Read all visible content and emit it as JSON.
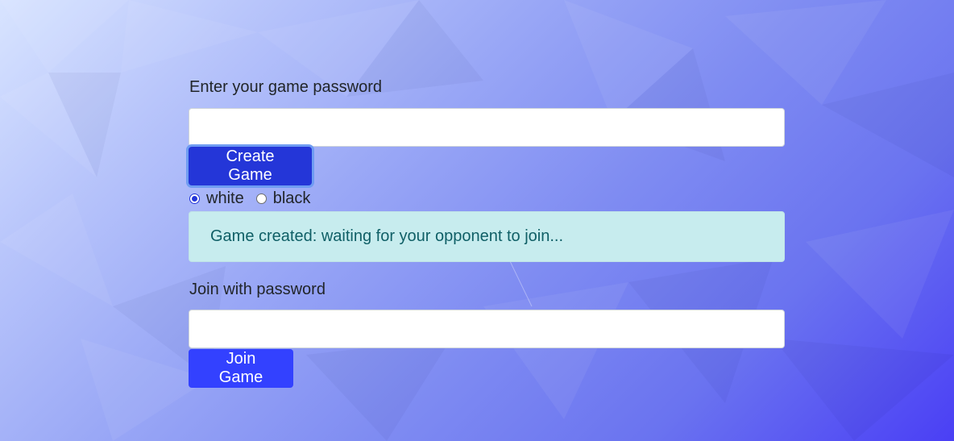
{
  "create": {
    "label": "Enter your game password",
    "password_value": "",
    "button_label": "Create Game",
    "colors": {
      "options": [
        "white",
        "black"
      ],
      "selected": "white"
    },
    "status_message": "Game created: waiting for your opponent to join..."
  },
  "join": {
    "label": "Join with password",
    "password_value": "",
    "button_label": "Join Game"
  },
  "theme": {
    "primary": "#2436d8",
    "join_button": "#3341ff",
    "alert_bg": "#c7ecee",
    "alert_text": "#0f5f66"
  }
}
